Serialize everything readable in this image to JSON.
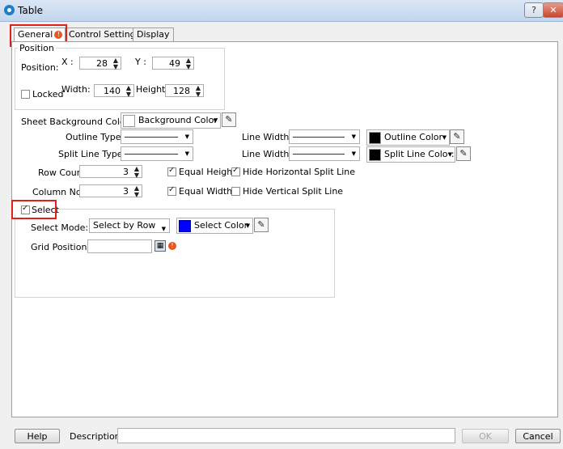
{
  "window": {
    "title": "Table",
    "help_glyph": "?",
    "close_glyph": "✕"
  },
  "tabs": [
    {
      "label": "General",
      "active": true,
      "badge": "!"
    },
    {
      "label": "Control Settings",
      "active": false
    },
    {
      "label": "Display",
      "active": false
    }
  ],
  "position": {
    "group_title": "Position",
    "position_label": "Position:",
    "x_label": "X :",
    "x_value": "28",
    "y_label": "Y :",
    "y_value": "49",
    "locked_label": "Locked",
    "locked_checked": false,
    "width_label": "Width:",
    "width_value": "140",
    "height_label": "Height:",
    "height_value": "128"
  },
  "sheet": {
    "bg_label": "Sheet Background Color:",
    "bg_color_button": "Background Color",
    "bg_color": "#ffffff",
    "outline_type_label": "Outline Type:",
    "outline_width_label": "Line Width:",
    "outline_color_button": "Outline Color",
    "outline_color": "#000000",
    "split_type_label": "Split Line Type:",
    "split_width_label": "Line Width:",
    "split_color_button": "Split Line Color:",
    "split_color": "#000000",
    "row_count_label": "Row Count:",
    "row_count_value": "3",
    "column_label": "Column No.:",
    "column_value": "3",
    "equal_height_label": "Equal Height",
    "equal_height_checked": true,
    "hide_horizontal_label": "Hide Horizontal Split Line",
    "hide_horizontal_checked": true,
    "equal_width_label": "Equal Width",
    "equal_width_checked": true,
    "hide_vertical_label": "Hide Vertical Split Line",
    "hide_vertical_checked": false
  },
  "select": {
    "checkbox_label": "Select",
    "checked": true,
    "mode_label": "Select Mode:",
    "mode_value": "Select by Row",
    "color_button": "Select Color",
    "select_color": "#0000ff",
    "grid_label": "Grid Position:",
    "grid_value": "",
    "warning_badge": "!"
  },
  "footer": {
    "help_button": "Help",
    "description_label": "Description:",
    "description_value": "",
    "ok_button": "OK",
    "cancel_button": "Cancel"
  },
  "colors": {
    "highlight_red": "#e0201c",
    "warning_orange": "#e8551e"
  }
}
